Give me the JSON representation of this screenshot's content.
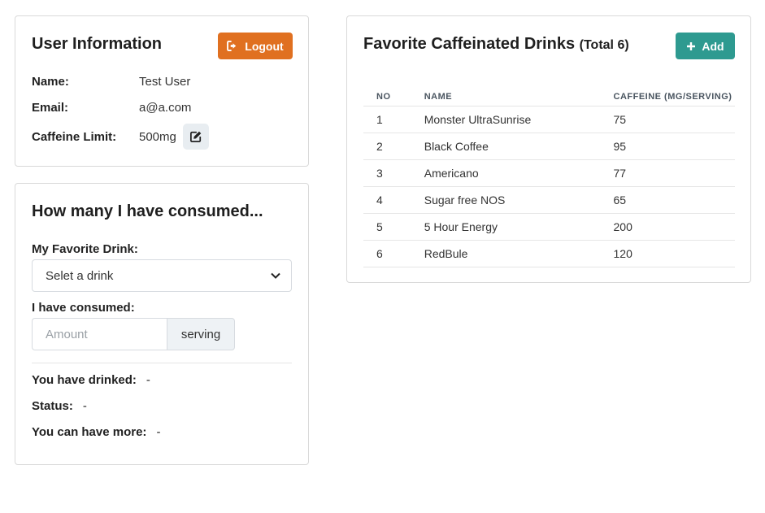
{
  "user_card": {
    "title": "User Information",
    "logout_label": "Logout",
    "name_label": "Name:",
    "name_value": "Test User",
    "email_label": "Email:",
    "email_value": "a@a.com",
    "limit_label": "Caffeine Limit:",
    "limit_value": "500mg",
    "edit_icon": "edit-icon"
  },
  "consume_card": {
    "title": "How many I have consumed...",
    "drink_label": "My Favorite Drink:",
    "drink_select_value": "Selet a drink",
    "consumed_label": "I have consumed:",
    "amount_placeholder": "Amount",
    "amount_unit": "serving",
    "drinked_label": "You have drinked:",
    "drinked_value": "-",
    "status_label": "Status:",
    "status_value": "-",
    "more_label": "You can have more:",
    "more_value": "-"
  },
  "drinks_card": {
    "title": "Favorite Caffeinated Drinks",
    "total": "(Total 6)",
    "add_label": "Add",
    "columns": [
      "NO",
      "NAME",
      "CAFFEINE (MG/SERVING)"
    ],
    "rows": [
      [
        "1",
        "Monster UltraSunrise",
        "75"
      ],
      [
        "2",
        "Black Coffee",
        "95"
      ],
      [
        "3",
        "Americano",
        "77"
      ],
      [
        "4",
        "Sugar free NOS",
        "65"
      ],
      [
        "5",
        "5 Hour Energy",
        "200"
      ],
      [
        "6",
        "RedBule",
        "120"
      ]
    ]
  },
  "colors": {
    "logout": "#e07020",
    "add": "#2e9a90"
  }
}
